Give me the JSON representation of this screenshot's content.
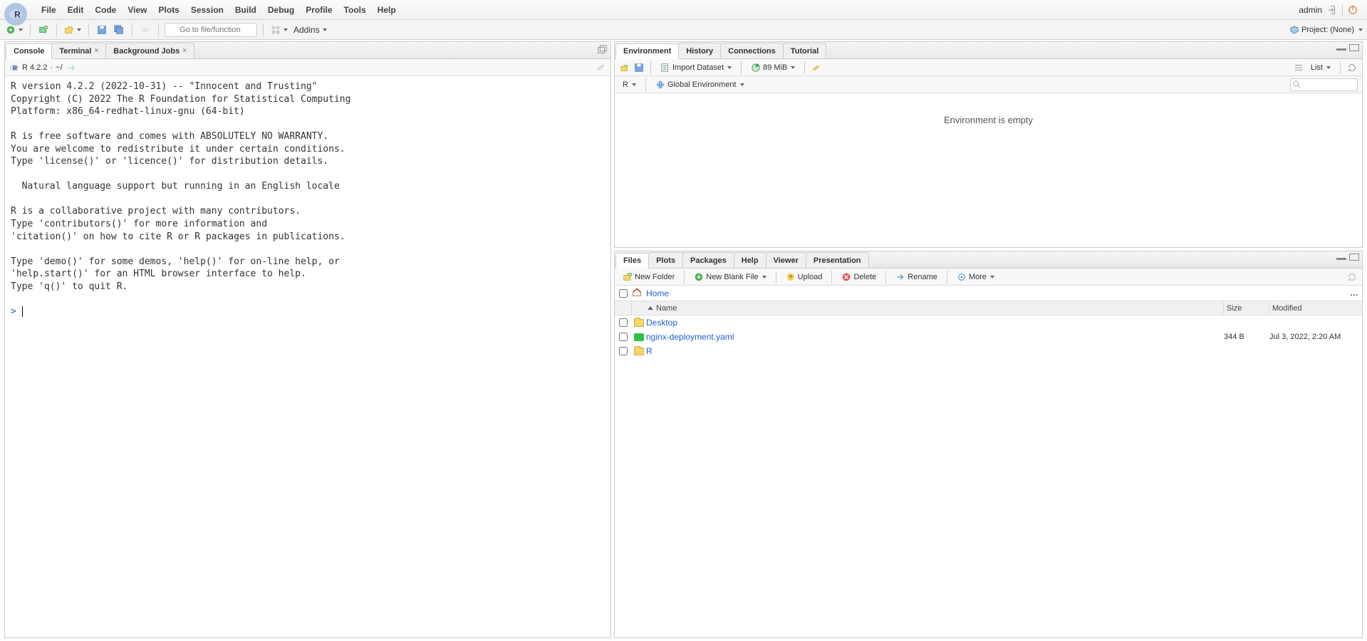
{
  "menubar": {
    "items": [
      "File",
      "Edit",
      "Code",
      "View",
      "Plots",
      "Session",
      "Build",
      "Debug",
      "Profile",
      "Tools",
      "Help"
    ],
    "user": "admin"
  },
  "toolbar": {
    "goto_placeholder": "Go to file/function",
    "addins_label": "Addins",
    "project_label": "Project: (None)"
  },
  "left": {
    "tabs": [
      "Console",
      "Terminal",
      "Background Jobs"
    ],
    "active_tab": 0,
    "subbar": {
      "version": "R 4.2.2",
      "path": "~/"
    },
    "console_text": "R version 4.2.2 (2022-10-31) -- \"Innocent and Trusting\"\nCopyright (C) 2022 The R Foundation for Statistical Computing\nPlatform: x86_64-redhat-linux-gnu (64-bit)\n\nR is free software and comes with ABSOLUTELY NO WARRANTY.\nYou are welcome to redistribute it under certain conditions.\nType 'license()' or 'licence()' for distribution details.\n\n  Natural language support but running in an English locale\n\nR is a collaborative project with many contributors.\nType 'contributors()' for more information and\n'citation()' on how to cite R or R packages in publications.\n\nType 'demo()' for some demos, 'help()' for on-line help, or\n'help.start()' for an HTML browser interface to help.\nType 'q()' to quit R.\n",
    "prompt": ">"
  },
  "env": {
    "tabs": [
      "Environment",
      "History",
      "Connections",
      "Tutorial"
    ],
    "active_tab": 0,
    "tb": {
      "import": "Import Dataset",
      "memory": "89 MiB",
      "list": "List",
      "lang": "R",
      "scope": "Global Environment"
    },
    "empty_msg": "Environment is empty"
  },
  "files": {
    "tabs": [
      "Files",
      "Plots",
      "Packages",
      "Help",
      "Viewer",
      "Presentation"
    ],
    "active_tab": 0,
    "tb": {
      "new_folder": "New Folder",
      "new_file": "New Blank File",
      "upload": "Upload",
      "delete": "Delete",
      "rename": "Rename",
      "more": "More"
    },
    "breadcrumb": "Home",
    "columns": {
      "name": "Name",
      "size": "Size",
      "modified": "Modified"
    },
    "rows": [
      {
        "type": "folder",
        "name": "Desktop",
        "size": "",
        "modified": ""
      },
      {
        "type": "yaml",
        "name": "nginx-deployment.yaml",
        "size": "344 B",
        "modified": "Jul 3, 2022, 2:20 AM"
      },
      {
        "type": "folder",
        "name": "R",
        "size": "",
        "modified": ""
      }
    ]
  }
}
